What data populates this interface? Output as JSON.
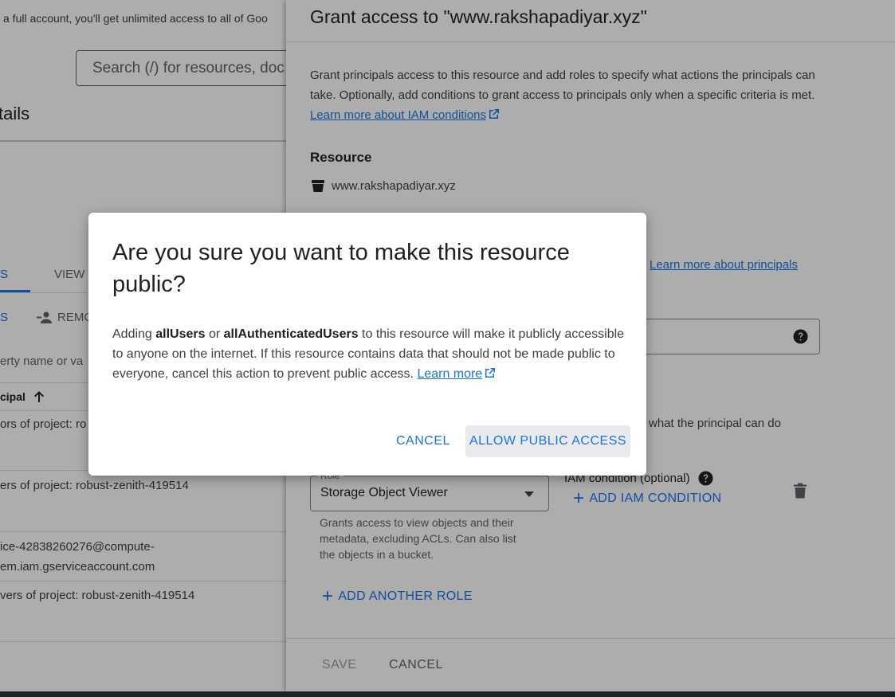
{
  "background": {
    "banner_text": "a full account, you'll get unlimited access to all of Goo",
    "search_placeholder": "Search (/) for resources, doc",
    "page_title": "tails",
    "tabs": [
      "S",
      "VIEW"
    ],
    "actions": {
      "grant": "S",
      "remove": "REMC"
    },
    "filter_placeholder": "erty name or va",
    "column_header": "cipal",
    "rows": [
      "ors of project: ro",
      "ers of project: robust-zenith-419514",
      "ice-42838260276@compute-",
      "em.iam.gserviceaccount.com",
      "vers of project: robust-zenith-419514"
    ]
  },
  "panel": {
    "title": "Grant access to \"www.rakshapadiyar.xyz\"",
    "description": "Grant principals access to this resource and add roles to specify what actions the principals can take. Optionally, add conditions to grant access to principals only when a specific criteria is met.",
    "description_link": "Learn more about IAM conditions",
    "resource_heading": "Resource",
    "resource_name": "www.rakshapadiyar.xyz",
    "principals_link": "Learn more about principals",
    "roles_text": "what the principal can do",
    "role_label": "Role",
    "role_value": "Storage Object Viewer",
    "role_help": "Grants access to view objects and their metadata, excluding ACLs. Can also list the objects in a bucket.",
    "iam_condition_label": "IAM condition (optional)",
    "add_iam_condition": "ADD IAM CONDITION",
    "add_another_role": "ADD ANOTHER ROLE",
    "save": "SAVE",
    "cancel": "CANCEL"
  },
  "dialog": {
    "title": "Are you sure you want to make this resource public?",
    "body_prefix": "Adding ",
    "bold_1": "allUsers",
    "body_or": " or ",
    "bold_2": "allAuthenticatedUsers",
    "body_rest": " to this resource will make it publicly accessible to anyone on the internet. If this resource contains data that should not be made public to everyone, cancel this action to prevent public access. ",
    "learn_more": "Learn more",
    "cancel": "CANCEL",
    "allow": "ALLOW PUBLIC ACCESS"
  },
  "colors": {
    "accent": "#1a73e8",
    "scrim": "rgba(0,0,0,0.32)"
  }
}
